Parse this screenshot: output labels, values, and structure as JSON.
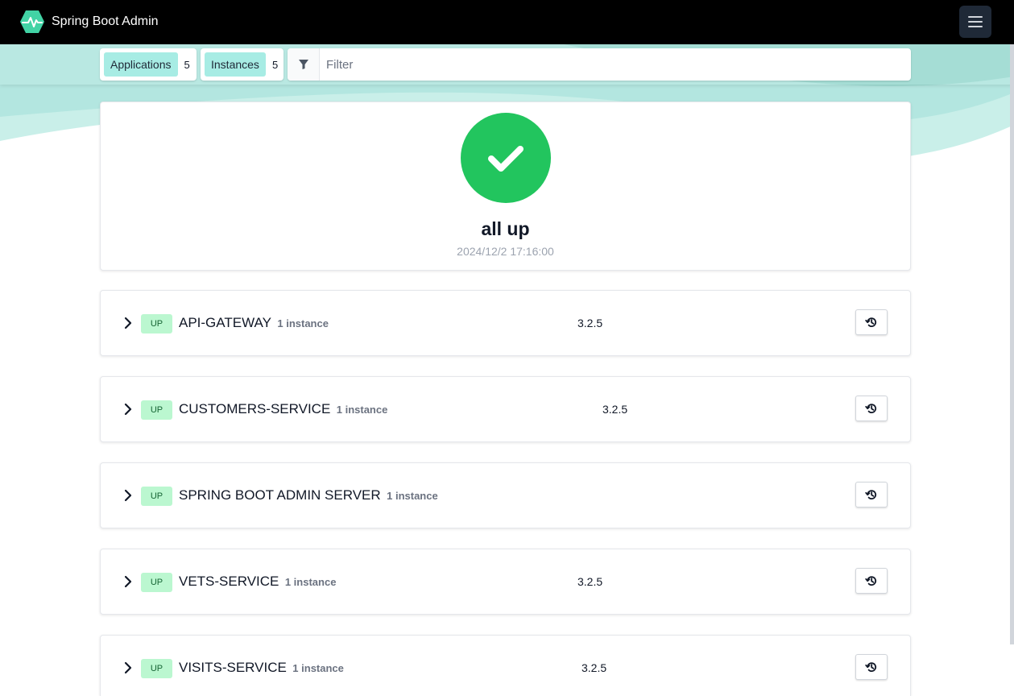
{
  "app": {
    "title": "Spring Boot Admin",
    "accent": "#42d3a5"
  },
  "toolbar": {
    "applications_label": "Applications",
    "applications_count": "5",
    "instances_label": "Instances",
    "instances_count": "5",
    "filter_placeholder": "Filter"
  },
  "status": {
    "title": "all up",
    "timestamp": "2024/12/2 17:16:00",
    "color": "#22c55e"
  },
  "applications": [
    {
      "status": "UP",
      "name": "API-GATEWAY",
      "instances": "1 instance",
      "version": "3.2.5"
    },
    {
      "status": "UP",
      "name": "CUSTOMERS-SERVICE",
      "instances": "1 instance",
      "version": "3.2.5"
    },
    {
      "status": "UP",
      "name": "SPRING BOOT ADMIN SERVER",
      "instances": "1 instance",
      "version": ""
    },
    {
      "status": "UP",
      "name": "VETS-SERVICE",
      "instances": "1 instance",
      "version": "3.2.5"
    },
    {
      "status": "UP",
      "name": "VISITS-SERVICE",
      "instances": "1 instance",
      "version": "3.2.5"
    }
  ],
  "icons": {
    "brand": "heartbeat-hexagon-icon",
    "menu": "hamburger-menu-icon",
    "filter": "filter-icon",
    "status": "checkmark-icon",
    "expand": "chevron-right-icon",
    "history": "history-icon"
  }
}
